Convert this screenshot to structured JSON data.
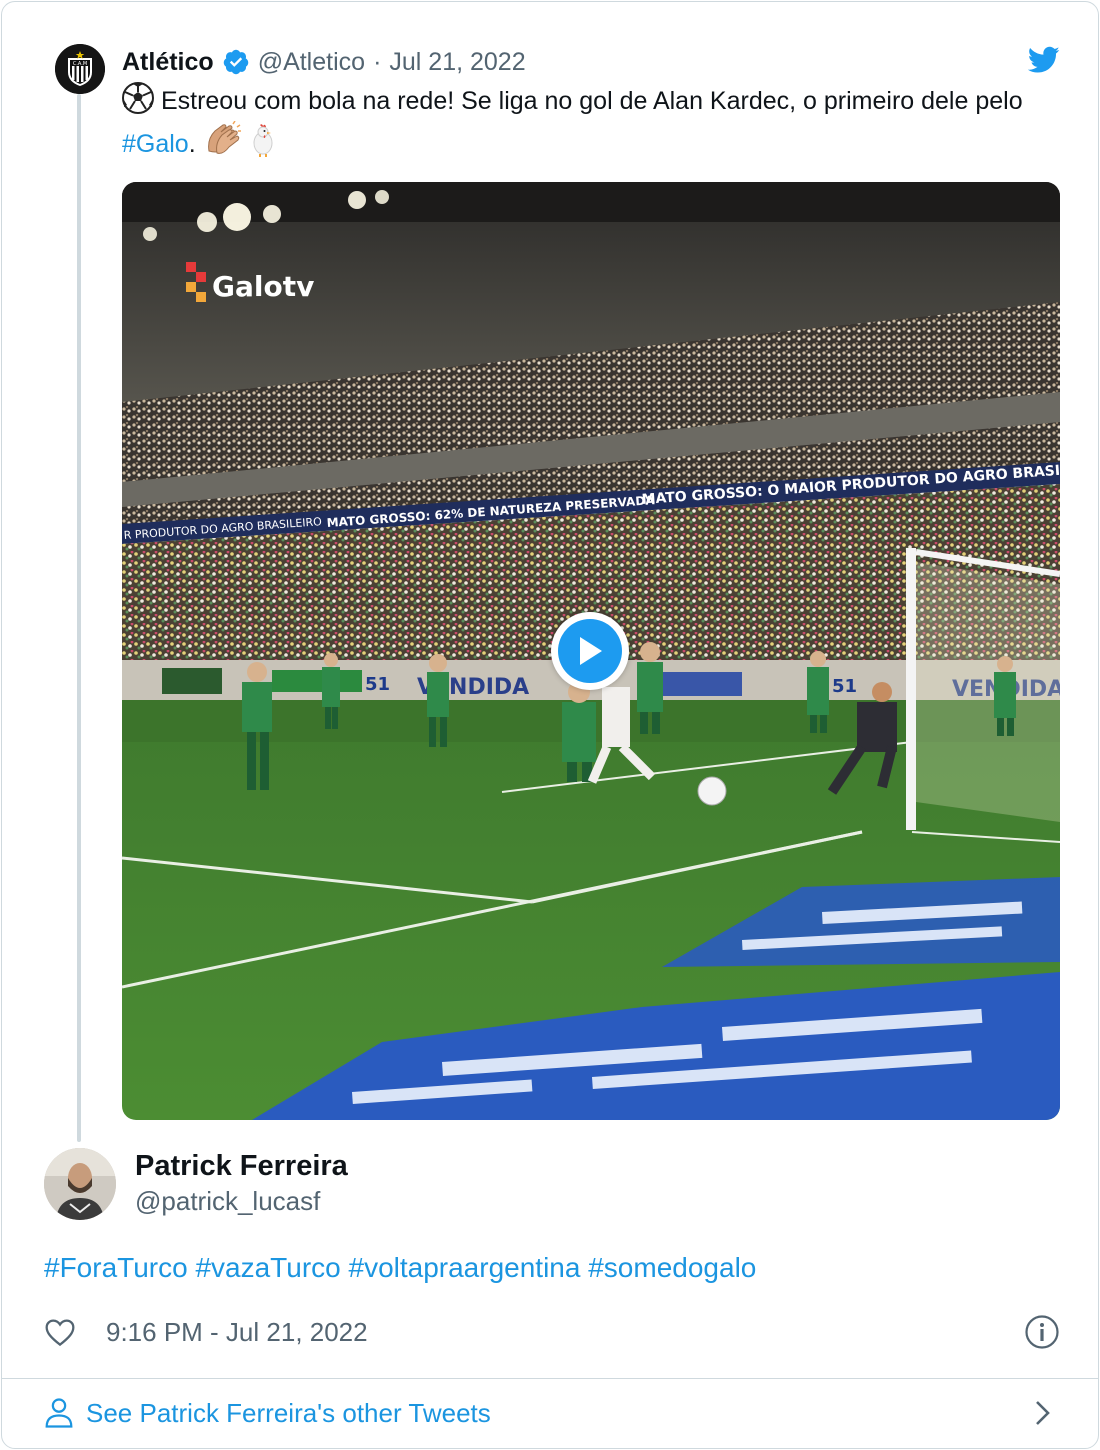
{
  "parent_tweet": {
    "author_name": "Atlético",
    "handle": "@Atletico",
    "separator": "·",
    "date": "Jul 21, 2022",
    "text_intro": "Estreou com bola na rede! Se liga no gol de Alan Kardec, o primeiro dele pelo ",
    "hashtag": "#Galo",
    "text_end": ". ",
    "media": {
      "watermark": "Galotv",
      "banner_left": "MATO GROSSO: 62% DE NATUREZA PRESERVADA",
      "banner_right": "MATO GROSSO: O MAIOR PRODUTOR DO AGRO BRASILEIRO",
      "banner_far_left": "R PRODUTOR DO AGRO BRASILEIRO",
      "ad_text": "VENDIDA",
      "ad_number": "51"
    }
  },
  "reply_tweet": {
    "author_name": "Patrick Ferreira",
    "handle": "@patrick_lucasf",
    "hashtags": [
      "#ForaTurco",
      "#vazaTurco",
      "#voltapraargentina",
      "#somedogalo"
    ],
    "timestamp": "9:16 PM - Jul 21, 2022"
  },
  "footer": {
    "link_text": "See Patrick Ferreira's other Tweets"
  },
  "colors": {
    "accent": "#1b95e0",
    "verified": "#1d9bf0",
    "muted": "#536471",
    "border": "#cfd9de"
  },
  "icons": [
    "twitter-bird-icon",
    "verified-badge-icon",
    "play-icon",
    "heart-icon",
    "info-icon",
    "person-icon",
    "chevron-right-icon",
    "soccer-ball-icon",
    "clapping-hands-icon",
    "rooster-icon"
  ]
}
